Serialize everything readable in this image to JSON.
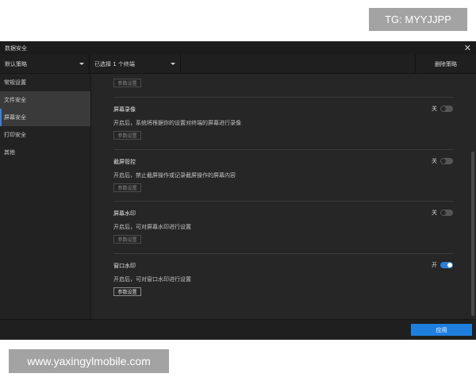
{
  "watermarks": {
    "tg": "TG: MYYJJPP",
    "url": "www.yaxingylmobile.com"
  },
  "dialog": {
    "title": "数据安全",
    "close_icon": "close-icon"
  },
  "toolbar": {
    "policy_select": "默认策略",
    "terminal_select": "已选择 1 个终端",
    "delete_label": "删除策略"
  },
  "sidebar": {
    "items": [
      {
        "label": "常规设置"
      },
      {
        "label": "文件安全"
      },
      {
        "label": "屏幕安全"
      },
      {
        "label": "打印安全"
      },
      {
        "label": "其他"
      }
    ]
  },
  "content": {
    "top_param_label": "参数设置",
    "sections": [
      {
        "name": "屏幕录像",
        "desc": "开启后，系统将根据你的设置对终端的屏幕进行录像",
        "toggle_label": "关",
        "on": false,
        "param_label": "参数设置"
      },
      {
        "name": "截屏管控",
        "desc": "开启后，禁止截屏操作或记录截屏操作的屏幕内容",
        "toggle_label": "关",
        "on": false,
        "param_label": "参数设置"
      },
      {
        "name": "屏幕水印",
        "desc": "开启后，可对屏幕水印进行设置",
        "toggle_label": "关",
        "on": false,
        "param_label": "参数设置"
      },
      {
        "name": "窗口水印",
        "desc": "开启后，可对窗口水印进行设置",
        "toggle_label": "开",
        "on": true,
        "param_label": "参数设置"
      }
    ]
  },
  "footer": {
    "apply_label": "应用"
  },
  "colors": {
    "accent": "#1f7fde",
    "background": "#262626"
  }
}
